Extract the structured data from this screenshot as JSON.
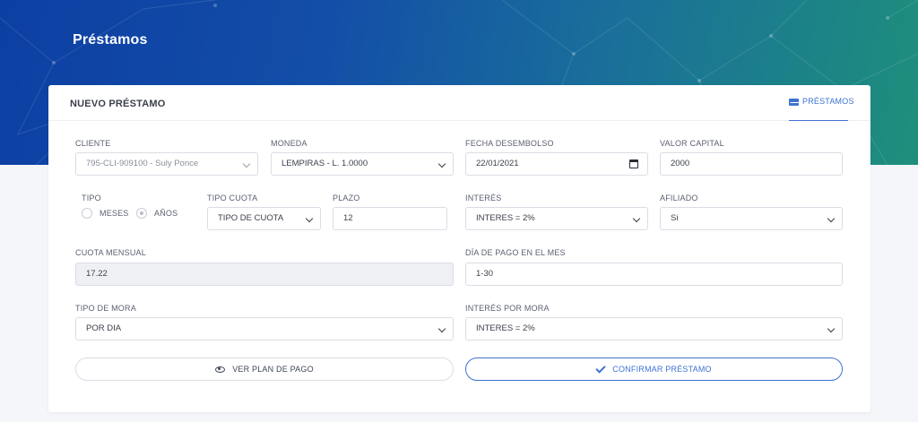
{
  "page": {
    "title": "Préstamos"
  },
  "card": {
    "title": "NUEVO PRÉSTAMO",
    "tab_label": "PRÉSTAMOS"
  },
  "form": {
    "cliente": {
      "label": "CLIENTE",
      "value": "795-CLI-909100 - Suly Ponce"
    },
    "moneda": {
      "label": "MONEDA",
      "value": "LEMPIRAS - L. 1.0000"
    },
    "fecha_desembolso": {
      "label": "FECHA DESEMBOLSO",
      "value": "22/01/2021"
    },
    "valor_capital": {
      "label": "VALOR CAPITAL",
      "value": "2000"
    },
    "tipo": {
      "label": "TIPO",
      "options": [
        "MESES",
        "AÑOS"
      ],
      "selected": "AÑOS"
    },
    "tipo_cuota": {
      "label": "TIPO CUOTA",
      "value": "TIPO DE CUOTA"
    },
    "plazo": {
      "label": "PLAZO",
      "value": "12"
    },
    "interes": {
      "label": "INTERÉS",
      "value": "INTERES = 2%"
    },
    "afiliado": {
      "label": "AFILIADO",
      "value": "Si"
    },
    "cuota_mensual": {
      "label": "CUOTA MENSUAL",
      "value": "17.22"
    },
    "dia_pago": {
      "label": "DÍA DE PAGO EN EL MES",
      "value": "1-30"
    },
    "tipo_mora": {
      "label": "TIPO DE MORA",
      "value": "POR DIA"
    },
    "interes_mora": {
      "label": "INTERÉS POR MORA",
      "value": "INTERES = 2%"
    }
  },
  "actions": {
    "ver_plan_label": "VER PLAN DE PAGO",
    "confirmar_label": "CONFIRMAR PRÉSTAMO"
  },
  "icons": {
    "tab": "envelope-icon",
    "ver_plan": "eye-icon",
    "confirmar": "check-icon",
    "fecha": "calendar-icon"
  },
  "colors": {
    "accent": "#3e72d2",
    "hero_start": "#0d3fa3",
    "hero_end": "#1e8f7c"
  }
}
